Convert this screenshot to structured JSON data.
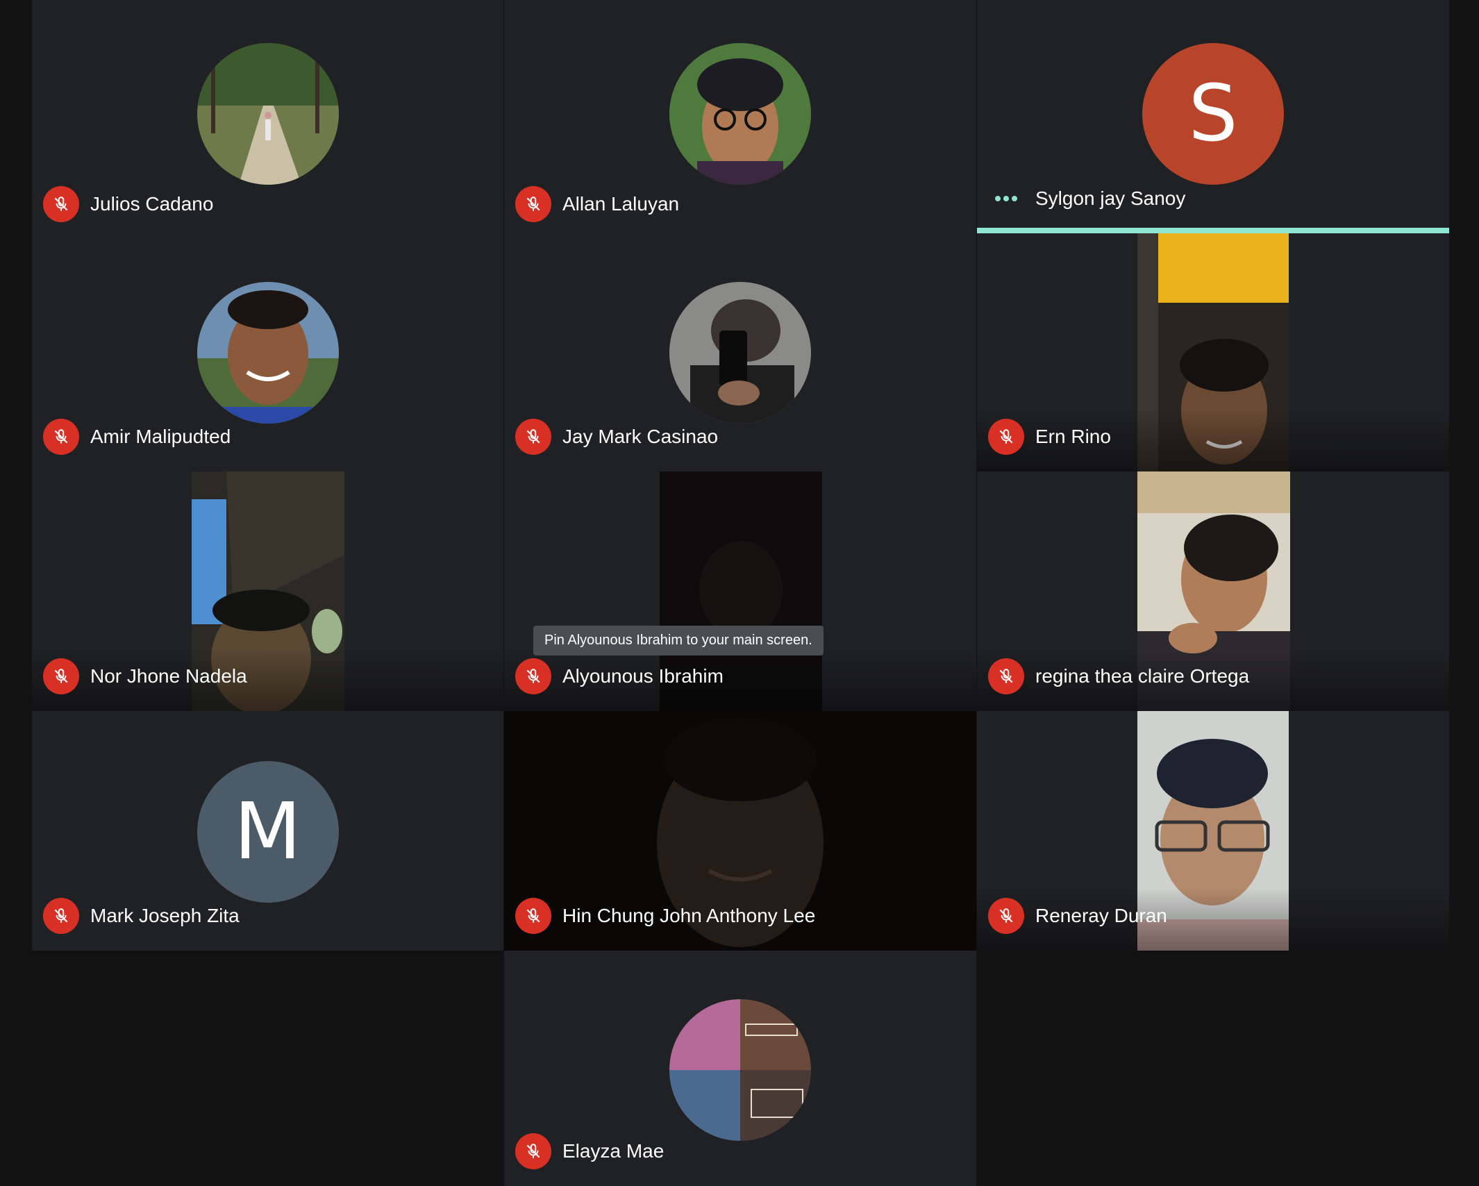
{
  "participants": [
    {
      "name": "Julios Cadano",
      "muted": true
    },
    {
      "name": "Allan Laluyan",
      "muted": true
    },
    {
      "name": "Sylgon jay Sanoy",
      "muted": false,
      "speaking": true,
      "avatar_letter": "S",
      "avatar_color": "#b8442a"
    },
    {
      "name": "Amir Malipudted",
      "muted": true
    },
    {
      "name": "Jay Mark Casinao",
      "muted": true
    },
    {
      "name": "Ern Rino",
      "muted": true
    },
    {
      "name": "Nor Jhone Nadela",
      "muted": true
    },
    {
      "name": "Alyounous Ibrahim",
      "muted": true
    },
    {
      "name": "regina thea claire Ortega",
      "muted": true
    },
    {
      "name": "Mark Joseph Zita",
      "muted": true,
      "avatar_letter": "M",
      "avatar_color": "#4b5b68"
    },
    {
      "name": "Hin Chung John Anthony Lee",
      "muted": true
    },
    {
      "name": "Reneray Duran",
      "muted": true
    },
    {
      "name": "Elayza Mae",
      "muted": true
    }
  ],
  "tooltip": "Pin Alyounous Ibrahim to your main screen.",
  "colors": {
    "tile_bg": "#202124",
    "page_bg": "#121212",
    "mute_red": "#d93025",
    "speaking_accent": "#8ee6d3"
  }
}
